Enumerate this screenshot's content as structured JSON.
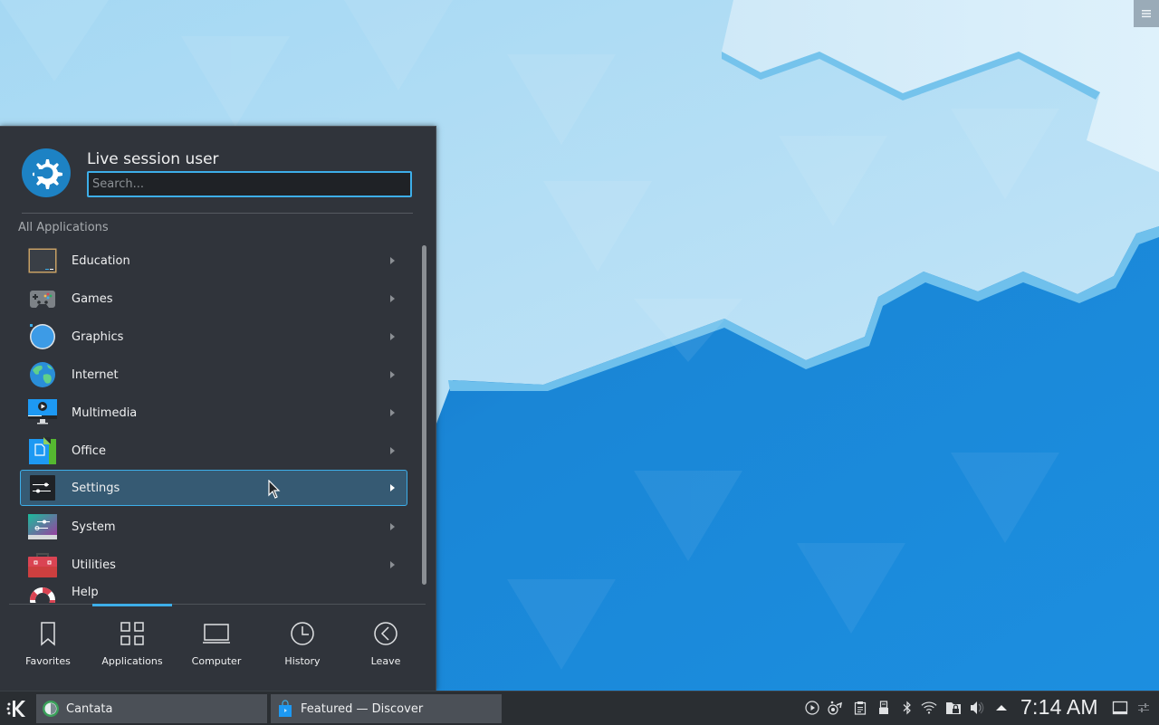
{
  "desktop": {
    "toolbox_icon": "hamburger-menu-icon"
  },
  "launcher": {
    "user_name": "Live session user",
    "search": {
      "placeholder": "Search...",
      "value": ""
    },
    "section_label": "All Applications",
    "categories": [
      {
        "label": "Education",
        "icon": "chalkboard-icon",
        "selected": false
      },
      {
        "label": "Games",
        "icon": "gamepad-icon",
        "selected": false
      },
      {
        "label": "Graphics",
        "icon": "graphics-disc-icon",
        "selected": false
      },
      {
        "label": "Internet",
        "icon": "globe-icon",
        "selected": false
      },
      {
        "label": "Multimedia",
        "icon": "monitor-play-icon",
        "selected": false
      },
      {
        "label": "Office",
        "icon": "office-document-icon",
        "selected": false
      },
      {
        "label": "Settings",
        "icon": "sliders-icon",
        "selected": true
      },
      {
        "label": "System",
        "icon": "system-settings-icon",
        "selected": false
      },
      {
        "label": "Utilities",
        "icon": "toolbox-icon",
        "selected": false
      },
      {
        "label": "Help",
        "icon": "lifebuoy-icon",
        "selected": false
      }
    ],
    "tabs": [
      {
        "label": "Favorites",
        "icon": "bookmark-icon",
        "active": false
      },
      {
        "label": "Applications",
        "icon": "grid-icon",
        "active": true
      },
      {
        "label": "Computer",
        "icon": "laptop-icon",
        "active": false
      },
      {
        "label": "History",
        "icon": "clock-icon",
        "active": false
      },
      {
        "label": "Leave",
        "icon": "back-circle-icon",
        "active": false
      }
    ]
  },
  "taskbar": {
    "launcher_icon": "kde-logo-icon",
    "tasks": [
      {
        "label": "Cantata",
        "icon": "cantata-icon"
      },
      {
        "label": "Featured — Discover",
        "icon": "discover-bag-icon"
      }
    ],
    "tray": [
      "media-player-icon",
      "kde-connect-icon",
      "clipboard-icon",
      "removable-device-icon",
      "bluetooth-icon",
      "wifi-icon",
      "vault-lock-icon",
      "volume-icon",
      "expand-tray-arrow-icon"
    ],
    "clock": "7:14 AM",
    "show_desktop_icon": "show-desktop-icon",
    "panel_settings_icon": "panel-settings-icon"
  }
}
